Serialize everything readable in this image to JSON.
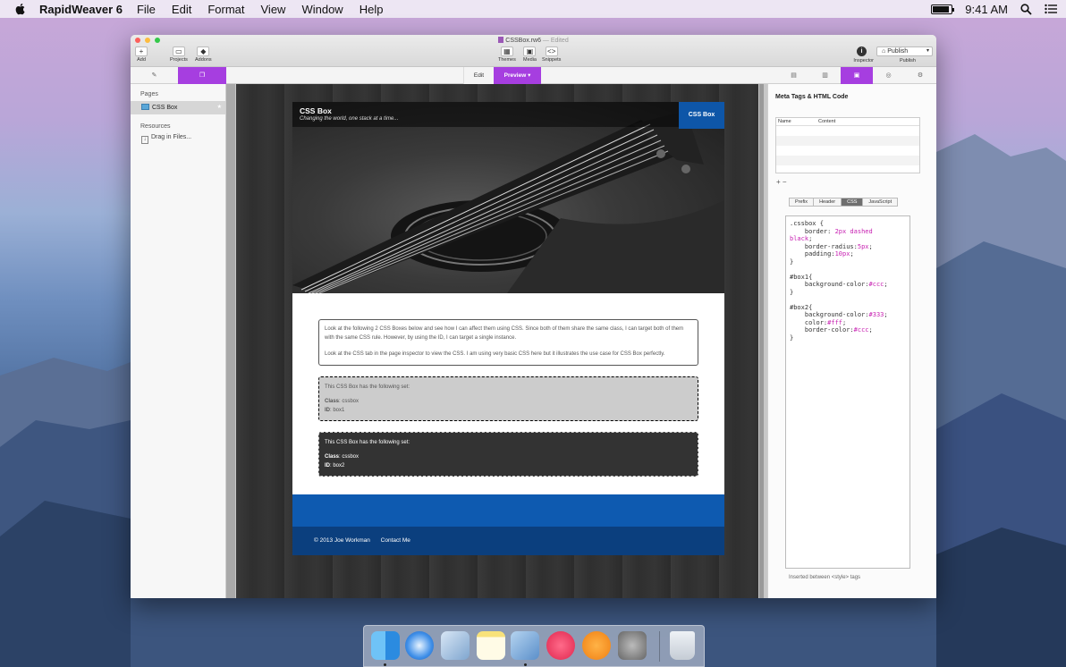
{
  "menubar": {
    "app_name": "RapidWeaver 6",
    "items": [
      "File",
      "Edit",
      "Format",
      "View",
      "Window",
      "Help"
    ],
    "time": "9:41 AM",
    "battery_level": 0.9
  },
  "window": {
    "doc_title": "CSSBox.rw6",
    "doc_state": "— Edited",
    "toolbar": {
      "add": "Add",
      "projects": "Projects",
      "addons": "Addons",
      "themes": "Themes",
      "media": "Media",
      "snippets": "Snippets",
      "inspector": "Inspector",
      "publish_button": "Publish",
      "publish_label": "Publish"
    },
    "view_tabs": {
      "edit": "Edit",
      "preview": "Preview"
    }
  },
  "sidebar": {
    "pages_heading": "Pages",
    "pages": [
      {
        "label": "CSS Box"
      }
    ],
    "resources_heading": "Resources",
    "resources_drop": "Drag in Files..."
  },
  "site": {
    "title": "CSS Box",
    "slogan": "Changing the world, one stack at a time...",
    "nav_item": "CSS Box",
    "intro_p1": "Look at the following 2 CSS Boxes below and see how I can affect them using CSS. Since both of them share the same class, I can target both of them with the same CSS rule. However, by using the ID, I can target a single instance.",
    "intro_p2": "Look at the CSS tab in the page inspector to view the CSS. I am using very basic CSS here but it illustrates the use case for CSS Box perfectly.",
    "box1": {
      "heading": "This CSS Box has the following set:",
      "class_label": "Class",
      "class_value": ": cssbox",
      "id_label": "ID",
      "id_value": ": box1"
    },
    "box2": {
      "heading": "This CSS Box has the following set:",
      "class_label": "Class",
      "class_value": ": cssbox",
      "id_label": "ID",
      "id_value": ": box2"
    },
    "footer_copyright": "© 2013 Joe Workman",
    "footer_link": "Contact Me"
  },
  "inspector": {
    "title": "Meta Tags & HTML Code",
    "col_name": "Name",
    "col_content": "Content",
    "add_remove": "+ −",
    "tabs": [
      "Prefix",
      "Header",
      "CSS",
      "JavaScript"
    ],
    "active_tab": "CSS",
    "footer_note": "Inserted between <style> tags"
  },
  "colors": {
    "accent": "#a63ee0",
    "site_blue": "#0e56a8",
    "footer_blue": "#0b3f7e"
  },
  "dock": {
    "apps": [
      "finder-icon",
      "safari-icon",
      "preview-icon",
      "notes-icon",
      "rapidweaver-icon",
      "itunes-icon",
      "ibooks-icon",
      "system-preferences-icon",
      "trash-icon"
    ]
  }
}
